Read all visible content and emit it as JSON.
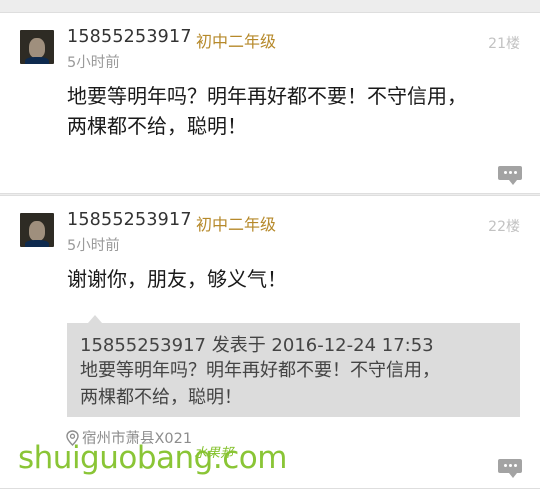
{
  "posts": [
    {
      "username": "15855253917",
      "grade": "初中二年级",
      "time": "5小时前",
      "floor": "21楼",
      "content_lines": [
        "地要等明年吗？明年再好都不要！不守信用，",
        "两棵都不给，聪明！"
      ]
    },
    {
      "username": "15855253917",
      "grade": "初中二年级",
      "time": "5小时前",
      "floor": "22楼",
      "content_lines": [
        "谢谢你，朋友，够义气！"
      ],
      "quote": {
        "header": "15855253917 发表于 2016-12-24 17:53",
        "lines": [
          "地要等明年吗？明年再好都不要！不守信用，",
          "两棵都不给，聪明！"
        ]
      },
      "location": "宿州市萧县X021"
    }
  ],
  "watermark": {
    "text": "shuiguobang.com",
    "cn": "水果邦"
  },
  "icons": {
    "avatar": "user-avatar",
    "reply": "comment-icon",
    "location": "location-pin-icon"
  },
  "colors": {
    "grade": "#b6892a",
    "watermark": "#84c22c"
  }
}
